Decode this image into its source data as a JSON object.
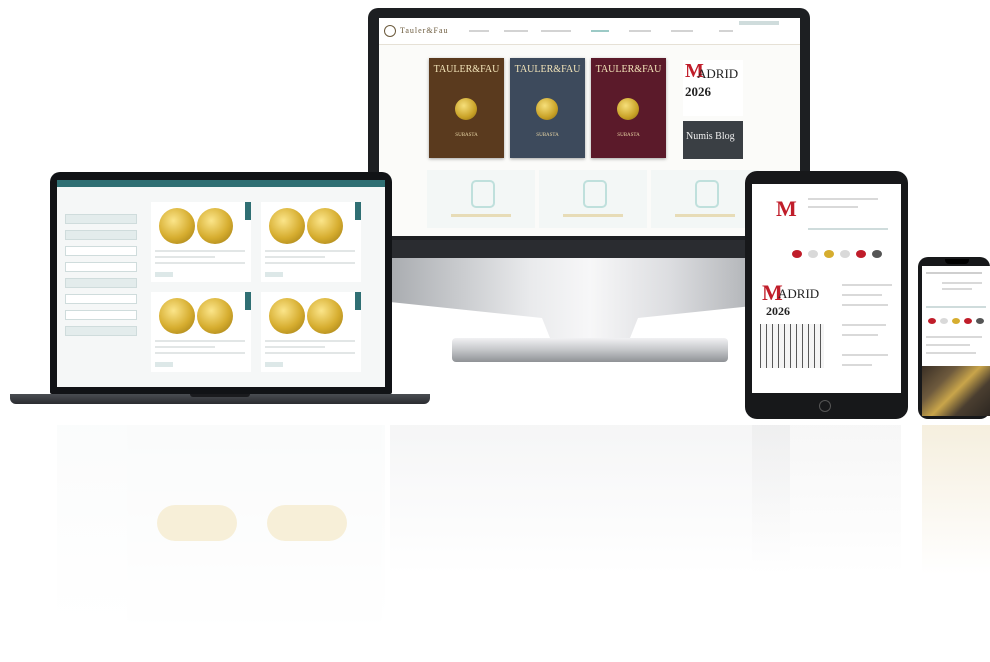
{
  "monitor": {
    "logo": "Tauler&Fau",
    "catalogs": [
      {
        "title": "TAULER&FAU",
        "subtitle": "SUBASTA",
        "bg": "#5a3a1e"
      },
      {
        "title": "TAULER&FAU",
        "subtitle": "SUBASTA",
        "bg": "#3d4a5c"
      },
      {
        "title": "TAULER&FAU",
        "subtitle": "SUBASTA",
        "bg": "#5b1a2a"
      }
    ],
    "madrid_brand": {
      "letter": "M",
      "rest": "ADRID",
      "year": "2026"
    },
    "blog_title": "Numis Blog"
  },
  "tablet": {
    "madrid_brand": {
      "letter": "M",
      "rest": "ADRID",
      "year": "2026"
    }
  },
  "colors": {
    "accent": "#2f6f73",
    "gold": "#d6ad2f",
    "brand_red": "#c01d2a"
  }
}
